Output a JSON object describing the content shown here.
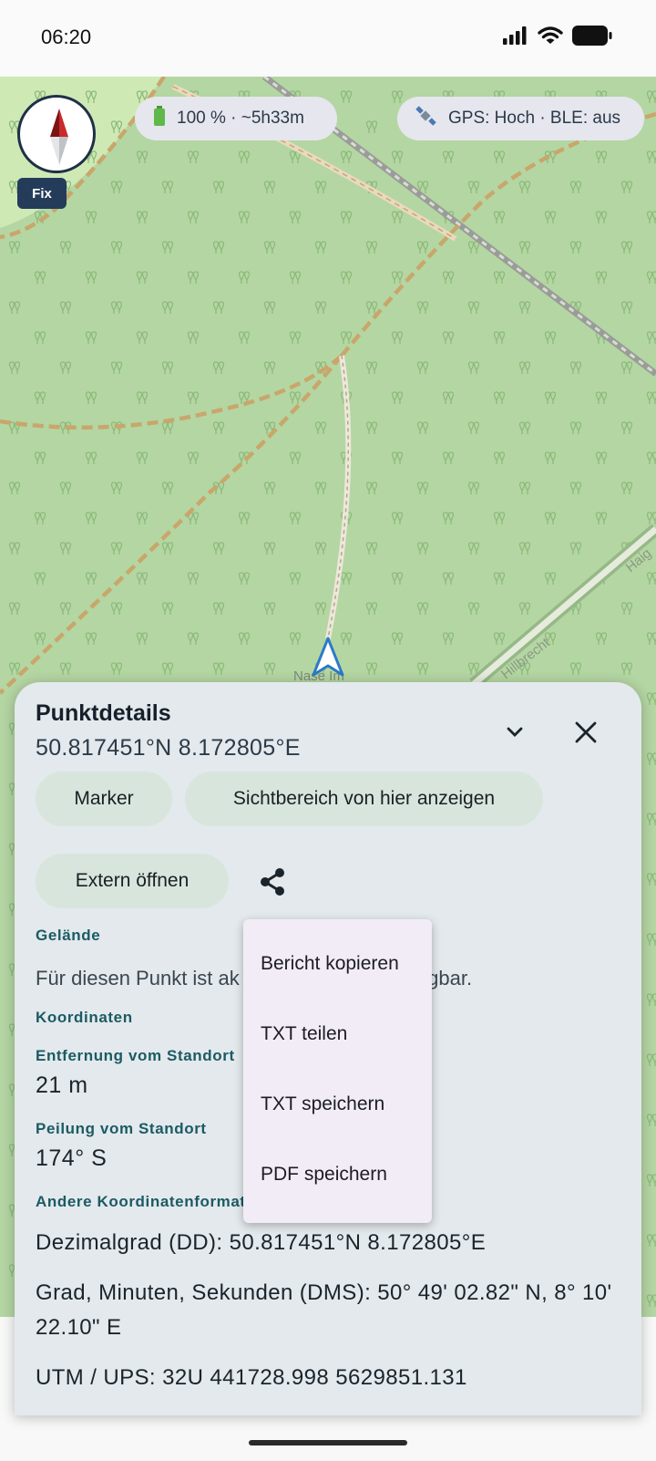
{
  "status_bar": {
    "time": "06:20"
  },
  "map": {
    "battery_chip": "100 % · ~5h33m",
    "gps_chip": "GPS: Hoch · BLE: aus",
    "fix_label": "Fix",
    "labels": {
      "nase": "Nase Im",
      "street": "Hillbrecht",
      "street2": "Haig"
    }
  },
  "sheet": {
    "title": "Punktdetails",
    "coords": "50.817451°N 8.172805°E",
    "buttons": {
      "marker": "Marker",
      "viewshed": "Sichtbereich von hier anzeigen",
      "open_external": "Extern öffnen"
    },
    "terrain": {
      "label": "Gelände",
      "text": "Für diesen Punkt ist ak",
      "text_suffix": "fügbar."
    },
    "coordinates_label": "Koordinaten",
    "distance": {
      "label": "Entfernung vom Standort",
      "value": "21 m"
    },
    "bearing": {
      "label": "Peilung vom Standort",
      "value": "174° S"
    },
    "other_formats": {
      "label": "Andere Koordinatenformat",
      "dd": "Dezimalgrad (DD): 50.817451°N 8.172805°E",
      "dms": "Grad, Minuten, Sekunden (DMS): 50° 49' 02.82\" N,  8° 10' 22.10\" E",
      "utm": "UTM / UPS: 32U 441728.998 5629851.131"
    }
  },
  "share_menu": {
    "items": [
      "Bericht kopieren",
      "TXT teilen",
      "TXT speichern",
      "PDF speichern"
    ]
  },
  "colors": {
    "map_bg": "#b4d6a3",
    "sheet_bg": "#e3e9ec",
    "accent": "#1c5a64",
    "pill_bg": "#d8e5dc",
    "menu_bg": "#f1ecf5"
  }
}
